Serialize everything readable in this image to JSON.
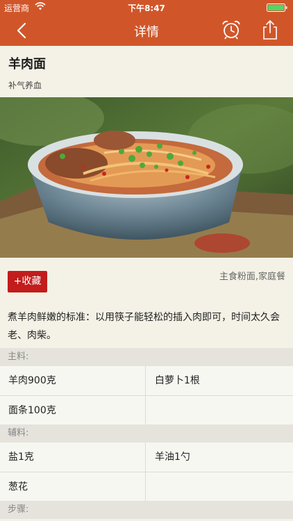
{
  "status": {
    "carrier": "运营商",
    "time": "下午8:47"
  },
  "nav": {
    "title": "详情",
    "back_icon": "chevron-left-icon",
    "alarm_icon": "alarm-clock-icon",
    "share_icon": "share-icon"
  },
  "dish": {
    "name": "羊肉面",
    "subtitle": "补气养血"
  },
  "actions": {
    "collect_label": "+收藏",
    "category": "主食粉面,家庭餐"
  },
  "description": "煮羊肉鲜嫩的标准：以用筷子能轻松的插入肉即可，时间太久会老、肉柴。",
  "main_ingredients": {
    "label": "主料:",
    "items": [
      "羊肉900克",
      "白萝卜1根",
      "面条100克",
      ""
    ]
  },
  "aux_ingredients": {
    "label": "辅料:",
    "items": [
      "盐1克",
      "羊油1勺",
      "葱花",
      ""
    ]
  },
  "steps": {
    "label": "步骤:"
  },
  "colors": {
    "nav": "#d0562a",
    "collect": "#c21c1c",
    "background": "#f4f2e6"
  }
}
